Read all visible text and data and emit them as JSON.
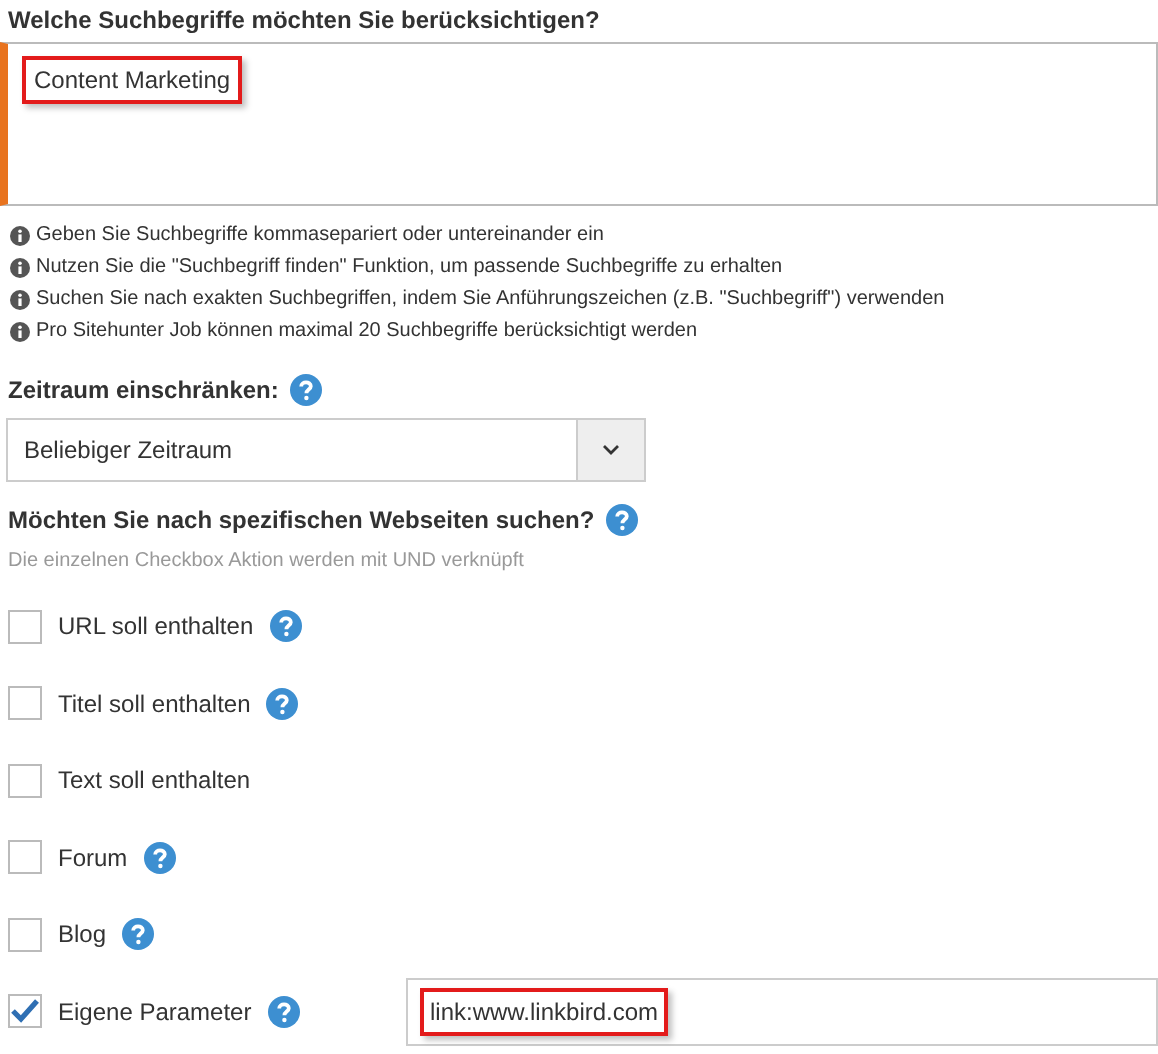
{
  "keywords": {
    "title": "Welche Suchbegriffe möchten Sie berücksichtigen?",
    "value": "Content Marketing",
    "hints": [
      "Geben Sie Suchbegriffe kommasepariert oder untereinander ein",
      "Nutzen Sie die \"Suchbegriff finden\" Funktion, um passende Suchbegriffe zu erhalten",
      "Suchen Sie nach exakten Suchbegriffen, indem Sie Anführungszeichen (z.B. \"Suchbegriff\") verwenden",
      "Pro Sitehunter Job können maximal 20 Suchbegriffe berücksichtigt werden"
    ]
  },
  "timeframe": {
    "title": "Zeitraum einschränken:",
    "value": "Beliebiger Zeitraum"
  },
  "websites": {
    "title": "Möchten Sie nach spezifischen Webseiten suchen?",
    "note": "Die einzelnen Checkbox Aktion werden mit UND verknüpft",
    "options": [
      {
        "label": "URL soll enthalten",
        "checked": false,
        "help": true
      },
      {
        "label": "Titel soll enthalten",
        "checked": false,
        "help": true
      },
      {
        "label": "Text soll enthalten",
        "checked": false,
        "help": false
      },
      {
        "label": "Forum",
        "checked": false,
        "help": true
      },
      {
        "label": "Blog",
        "checked": false,
        "help": true
      },
      {
        "label": "Eigene Parameter",
        "checked": true,
        "help": true,
        "field_value": "link:www.linkbird.com"
      }
    ]
  }
}
